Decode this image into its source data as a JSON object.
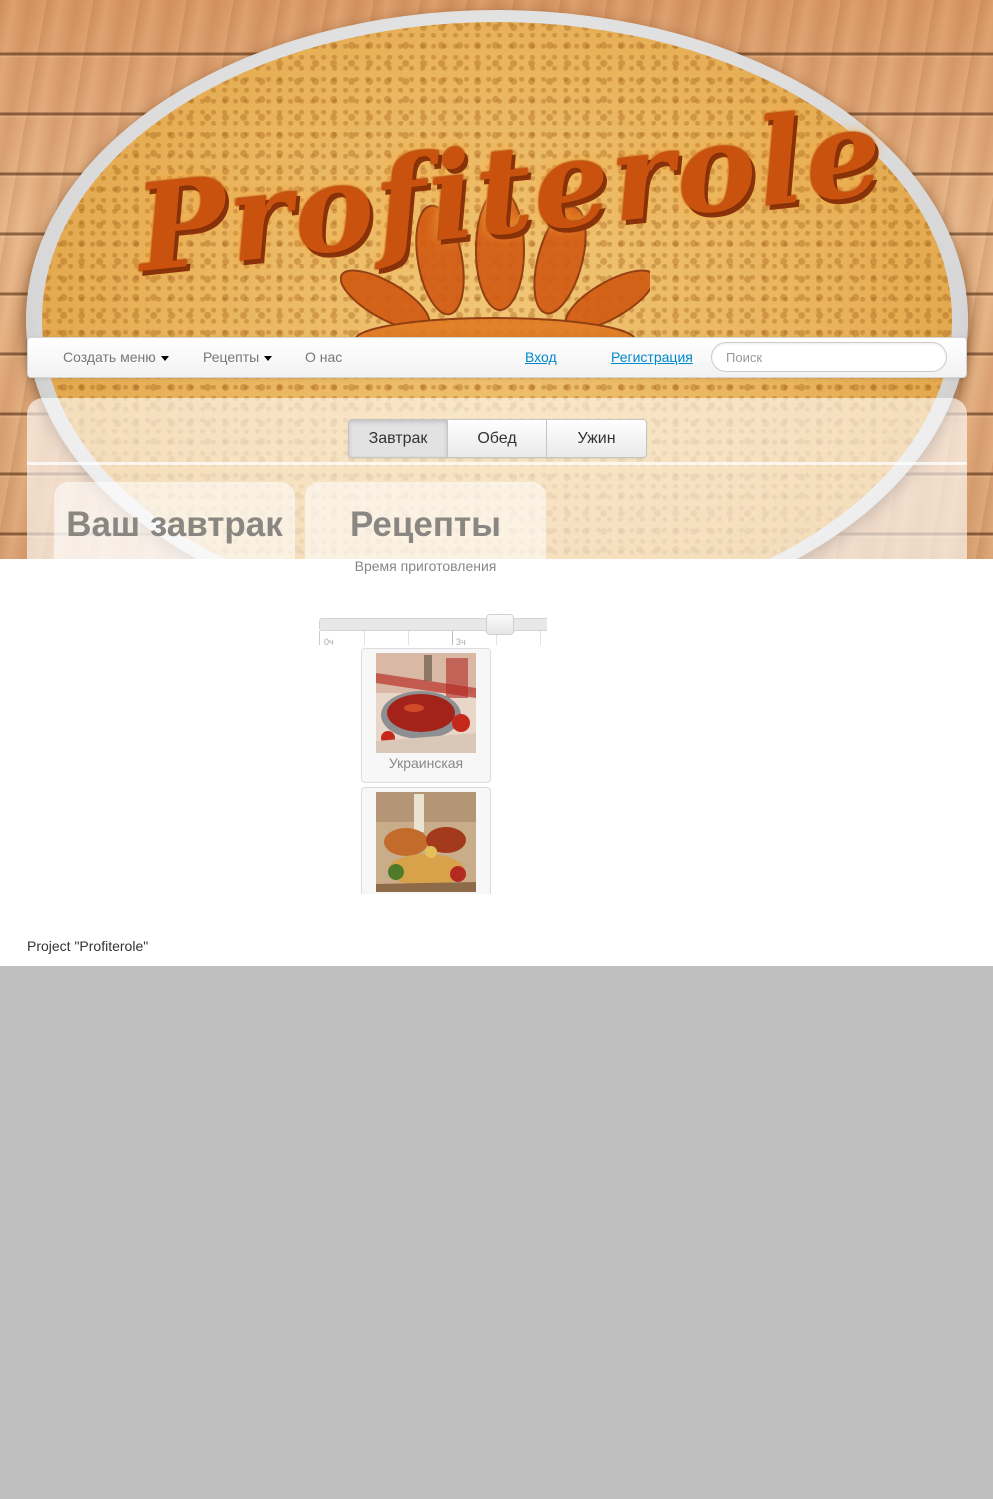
{
  "brand": {
    "logo_text": "Profiterole"
  },
  "navbar": {
    "menu_items": [
      {
        "label": "Создать меню",
        "has_dropdown": true
      },
      {
        "label": "Рецепты",
        "has_dropdown": true
      },
      {
        "label": "О нас",
        "has_dropdown": false
      }
    ],
    "login_label": "Вход",
    "register_label": "Регистрация",
    "search": {
      "placeholder": "Поиск",
      "value": ""
    }
  },
  "meal_tabs": {
    "items": [
      "Завтрак",
      "Обед",
      "Ужин"
    ],
    "active": "Завтрак"
  },
  "left_card": {
    "title": "Ваш завтрак"
  },
  "recipes_card": {
    "title": "Рецепты",
    "subtitle": "Время приготовления",
    "slider": {
      "min_label": "0ч",
      "mid_label": "3ч"
    }
  },
  "recipes": [
    {
      "label": "Украинская",
      "image": "borscht-photo"
    },
    {
      "label": "",
      "image": "feast-photo"
    }
  ],
  "footer": {
    "text": "Project \"Profiterole\""
  },
  "colors": {
    "link": "#0088cc",
    "heading": "#8a8682",
    "outer_bg": "#bfbfbf"
  }
}
